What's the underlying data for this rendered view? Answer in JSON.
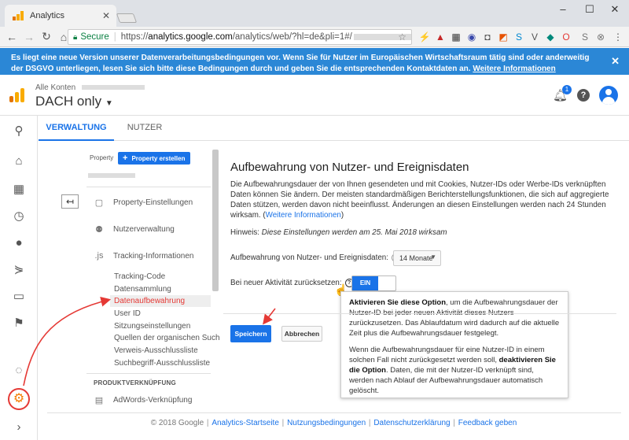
{
  "browser": {
    "tab_title": "Analytics",
    "url_secure_label": "Secure",
    "url_prefix": "https://",
    "url_host": "analytics.google.com",
    "url_path": "/analytics/web/?hl=de&pli=1#/"
  },
  "banner": {
    "text": "Es liegt eine neue Version unserer Datenverarbeitungsbedingungen vor. Wenn Sie für Nutzer im Europäischen Wirtschaftsraum tätig sind oder anderweitig der DSGVO unterliegen, lesen Sie sich bitte diese Bedingungen durch und geben Sie die entsprechenden Kontaktdaten an.",
    "link": "Weitere Informationen",
    "color": "#2b87d6"
  },
  "header": {
    "breadcrumb": "Alle Konten",
    "account": "DACH only",
    "notification_count": "1"
  },
  "tabs": [
    {
      "label": "VERWALTUNG"
    },
    {
      "label": "NUTZER"
    }
  ],
  "property": {
    "label": "Property",
    "create_button": "Property erstellen",
    "items": [
      {
        "label": "Property-Einstellungen",
        "icon": "page-icon"
      },
      {
        "label": "Nutzerverwaltung",
        "icon": "group-icon"
      },
      {
        "label": "Tracking-Informationen",
        "icon": "js-icon"
      }
    ],
    "js_glyph": ".js",
    "subitems": [
      "Tracking-Code",
      "Datensammlung",
      "Datenaufbewahrung",
      "User ID",
      "Sitzungseinstellungen",
      "Quellen der organischen Such",
      "Verweis-Ausschlussliste",
      "Suchbegriff-Ausschlussliste"
    ],
    "section": "PRODUKTVERKNÜPFUNG",
    "section_items": [
      {
        "label": "AdWords-Verknüpfung"
      }
    ]
  },
  "main": {
    "title": "Aufbewahrung von Nutzer- und Ereignisdaten",
    "description": "Die Aufbewahrungsdauer der von Ihnen gesendeten und mit Cookies, Nutzer-IDs oder Werbe-IDs verknüpften Daten können Sie ändern. Der meisten standardmäßigen Berichterstellungsfunktionen, die sich auf aggregierte Daten stützen, werden davon nicht beeinflusst. Änderungen an diesen Einstellungen werden nach 24 Stunden wirksam. (",
    "description_link": "Weitere Informationen",
    "description_end": ")",
    "hint_label": "Hinweis:",
    "hint_text": "Diese Einstellungen werden am 25. Mai 2018 wirksam",
    "retention_label": "Aufbewahrung von Nutzer- und Ereignisdaten:",
    "retention_value": "14 Monate",
    "reset_label": "Bei neuer Aktivität zurücksetzen:",
    "reset_toggle": "EIN",
    "save_button": "Speichern",
    "cancel_button": "Abbrechen"
  },
  "tooltip": {
    "p1_bold": "Aktivieren Sie diese Option",
    "p1_text": ", um die Aufbewahrungsdauer der Nutzer-ID bei jeder neuen Aktivität dieses Nutzers zurückzusetzen. Das Ablaufdatum wird dadurch auf die aktuelle Zeit plus die Aufbewahrungsdauer festgelegt.",
    "p2_text_a": "Wenn die Aufbewahrungsdauer für eine Nutzer-ID in einem solchen Fall nicht zurückgesetzt werden soll, ",
    "p2_bold": "deaktivieren Sie die Option",
    "p2_text_b": ". Daten, die mit der Nutzer-ID verknüpft sind, werden nach Ablauf der Aufbewahrungsdauer automatisch gelöscht."
  },
  "footer": {
    "copyright": "© 2018 Google",
    "links": [
      "Analytics-Startseite",
      "Nutzungsbedingungen",
      "Datenschutzerklärung",
      "Feedback geben"
    ]
  },
  "colors": {
    "accent": "#1a73e8",
    "annotation": "#e53935"
  }
}
